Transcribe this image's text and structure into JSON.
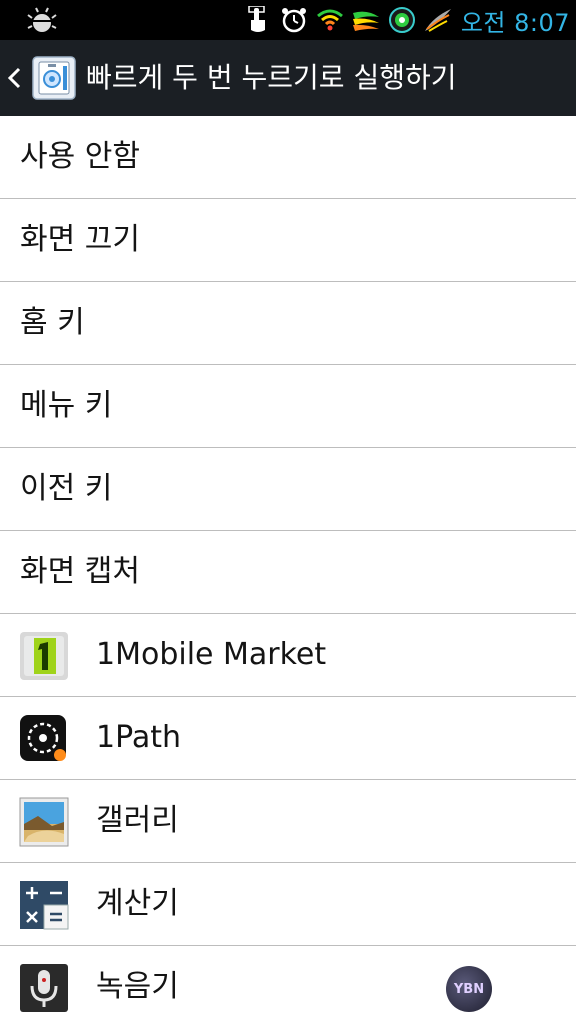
{
  "status_bar": {
    "time": "오전 8:07",
    "icons": [
      "bug-icon",
      "touch-icon",
      "alarm-icon",
      "wifi-icon",
      "wing-icon",
      "badge-icon",
      "feather-icon"
    ]
  },
  "action_bar": {
    "title": "빠르게 두 번 누르기로 실행하기",
    "icon": "app-icon"
  },
  "list": {
    "items": [
      {
        "label": "사용 안함"
      },
      {
        "label": "화면 끄기"
      },
      {
        "label": "홈 키"
      },
      {
        "label": "메뉴 키"
      },
      {
        "label": "이전 키"
      },
      {
        "label": "화면 캡처"
      },
      {
        "label": "1Mobile Market",
        "icon": "1mobile-market-icon"
      },
      {
        "label": "1Path",
        "icon": "1path-icon"
      },
      {
        "label": "갤러리",
        "icon": "gallery-icon"
      },
      {
        "label": "계산기",
        "icon": "calculator-icon"
      },
      {
        "label": "녹음기",
        "icon": "voice-recorder-icon"
      }
    ]
  },
  "watermark": {
    "text": "YBN"
  },
  "colors": {
    "status_time": "#33b5e5",
    "action_bar_bg": "#1b1f24",
    "divider": "#bdbdbd",
    "text": "#141414"
  }
}
